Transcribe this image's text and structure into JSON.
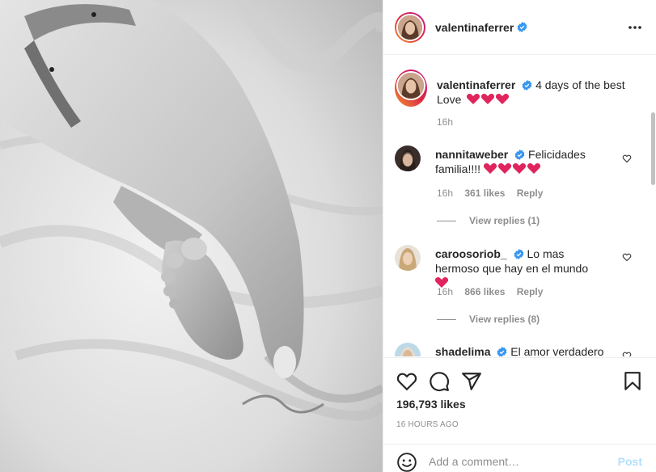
{
  "post": {
    "author": "valentinaferrer",
    "caption": "4 days of the best Love",
    "caption_time": "16h",
    "likes": "196,793 likes",
    "timestamp": "16 HOURS AGO"
  },
  "comments": [
    {
      "user": "nannitaweber",
      "text": "Felicidades familia!!!!",
      "hearts": 4,
      "time": "16h",
      "likes": "361 likes",
      "reply": "Reply",
      "view_replies": "View replies (1)"
    },
    {
      "user": "caroosoriob_",
      "text": "Lo mas hermoso que hay en el mundo",
      "hearts": 1,
      "time": "16h",
      "likes": "866 likes",
      "reply": "Reply",
      "view_replies": "View replies (8)"
    },
    {
      "user": "shadelima",
      "text": "El amor verdadero"
    }
  ],
  "add_comment": {
    "placeholder": "Add a comment…",
    "post_label": "Post"
  },
  "icons": [
    "more-options-icon",
    "verified-badge-icon",
    "like-icon",
    "comment-icon",
    "share-icon",
    "save-icon",
    "emoji-icon"
  ],
  "colors": {
    "verified": "#3897f0",
    "heart_emoji": "#e0245e",
    "post_disabled": "#b2dffc",
    "meta": "#8e8e8e"
  }
}
